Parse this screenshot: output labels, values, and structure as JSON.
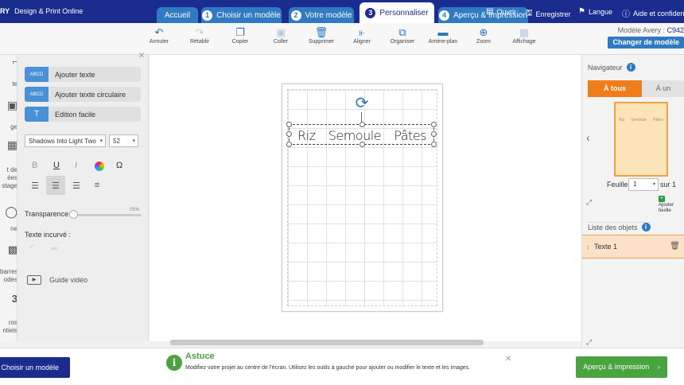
{
  "header": {
    "brand_logo": "RY",
    "brand_title": "Design & Print Online",
    "tabs": [
      {
        "num": "",
        "label": "Accueil"
      },
      {
        "num": "1",
        "label": "Choisir un modèle"
      },
      {
        "num": "2",
        "label": "Votre modèle"
      },
      {
        "num": "3",
        "label": "Personnaliser"
      },
      {
        "num": "4",
        "label": "Aperçu & Impression"
      }
    ],
    "active_tab": "Personnaliser",
    "actions": {
      "open": "Ouvrir",
      "save": "Enregistrer",
      "language": "Langue",
      "help": "Aide et confidenti"
    }
  },
  "toolbar": {
    "items": [
      {
        "label": "Annuler",
        "icon": "undo-icon"
      },
      {
        "label": "Rétablir",
        "icon": "redo-icon"
      },
      {
        "label": "Copier",
        "icon": "copy-icon"
      },
      {
        "label": "Coller",
        "icon": "paste-icon"
      },
      {
        "label": "Supprimer",
        "icon": "trash-icon"
      },
      {
        "label": "Aligner",
        "icon": "align-icon"
      },
      {
        "label": "Organiser",
        "icon": "arrange-icon"
      },
      {
        "label": "Arrière-plan",
        "icon": "background-icon"
      },
      {
        "label": "Zoom",
        "icon": "zoom-icon"
      },
      {
        "label": "Affichage",
        "icon": "grid-icon"
      }
    ],
    "model_prefix": "Modèle Avery :",
    "model_code": "C942",
    "change_model": "Changer de modèle"
  },
  "rail": {
    "items": [
      "te",
      "ge",
      "t de",
      "ées",
      "stage",
      "ne",
      "barres",
      "odes",
      "3",
      "ros",
      "ntiels"
    ]
  },
  "left_panel": {
    "add_text": "Ajouter texte",
    "add_text_icon_label": "ABCD",
    "add_curved_text": "Ajouter texte circulaire",
    "add_curved_icon_label": "ABCD",
    "easy_edit": "Edition facile",
    "font": "Shadows Into Light Two",
    "font_size": "52",
    "format_buttons": [
      "B",
      "U",
      "I",
      "Ω"
    ],
    "transparency_label": "Transparence",
    "transparency_value": "05%",
    "transparency": 0.05,
    "curved_label": "Texte incurvé :",
    "video_label": "Guide vidéo"
  },
  "canvas": {
    "words": [
      "Riz",
      "Semoule",
      "Pâtes"
    ]
  },
  "navigator": {
    "title": "Navigateur",
    "tab_all": "À tous",
    "tab_one": "À un",
    "thumb_words": [
      "Riz",
      "Semoule",
      "Pâtes"
    ],
    "sheet_label": "Feuille",
    "sheet_value": "1",
    "sheet_total": "sur 1",
    "add_sheet": "Ajouter feuille"
  },
  "objects": {
    "title": "Liste des objets",
    "items": [
      "Texte 1"
    ]
  },
  "footer": {
    "choose_model": "Choisir un modèle",
    "tip_title": "Astuce",
    "tip_text": "Modifiez votre projet au centre de l'écran. Utilisez les outils à gauche pour ajouter ou modifier le texte et les images.",
    "preview": "Aperçu & impression"
  },
  "colors": {
    "header_bg": "#1b2c8f",
    "tab_bg": "#2f7ac2",
    "accent_orange": "#ef7d19",
    "accent_green": "#49a33e"
  }
}
